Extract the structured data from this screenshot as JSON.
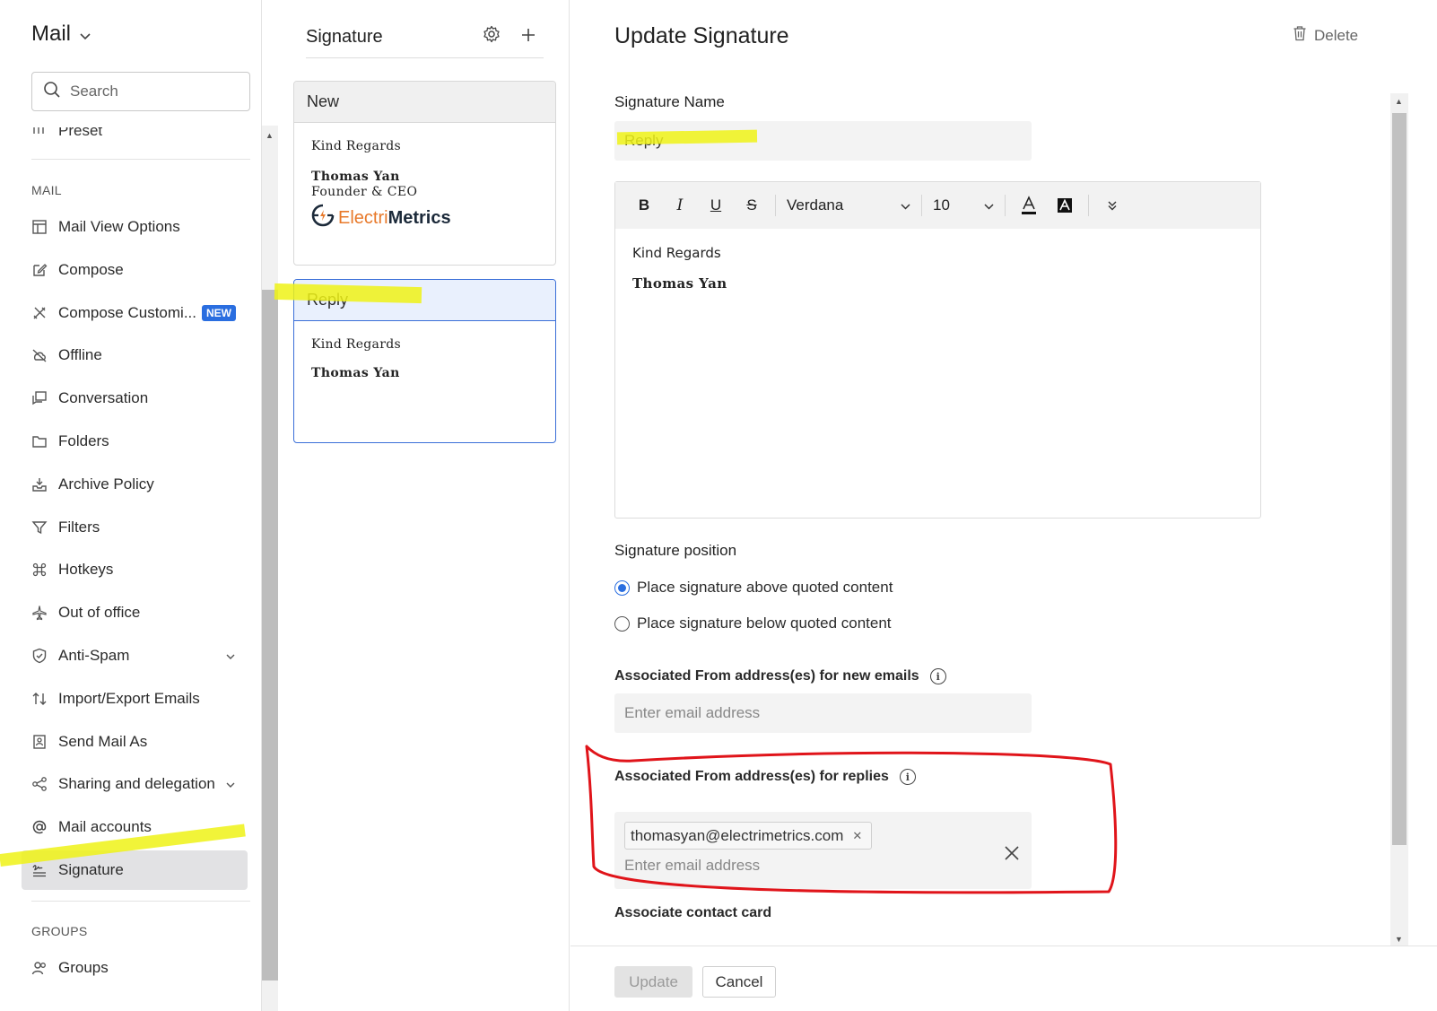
{
  "app": {
    "title": "Mail",
    "search_placeholder": "Search"
  },
  "sidebar": {
    "preset_label": "Preset",
    "section_mail": "MAIL",
    "section_groups": "GROUPS",
    "items": [
      {
        "label": "Mail View Options",
        "icon": "layout-icon"
      },
      {
        "label": "Compose",
        "icon": "compose-icon"
      },
      {
        "label": "Compose Customi...",
        "icon": "tools-icon",
        "badge": "NEW"
      },
      {
        "label": "Offline",
        "icon": "cloud-off-icon"
      },
      {
        "label": "Conversation",
        "icon": "conversation-icon"
      },
      {
        "label": "Folders",
        "icon": "folder-icon"
      },
      {
        "label": "Archive Policy",
        "icon": "archive-icon"
      },
      {
        "label": "Filters",
        "icon": "filter-icon"
      },
      {
        "label": "Hotkeys",
        "icon": "command-icon"
      },
      {
        "label": "Out of office",
        "icon": "plane-icon"
      },
      {
        "label": "Anti-Spam",
        "icon": "shield-icon"
      },
      {
        "label": "Import/Export Emails",
        "icon": "swap-icon"
      },
      {
        "label": "Send Mail As",
        "icon": "send-as-icon"
      },
      {
        "label": "Sharing and delegation",
        "icon": "share-icon"
      },
      {
        "label": "Mail accounts",
        "icon": "at-icon"
      },
      {
        "label": "Signature",
        "icon": "signature-icon",
        "active": true
      }
    ],
    "groups_item": {
      "label": "Groups",
      "icon": "groups-icon"
    }
  },
  "signature_list": {
    "title": "Signature",
    "cards": [
      {
        "name": "New",
        "regards": "Kind Regards",
        "person": "Thomas Yan",
        "role": "Founder & CEO",
        "logo_part1": "Electri",
        "logo_part2": "Metrics"
      },
      {
        "name": "Reply",
        "regards": "Kind Regards",
        "person": "Thomas Yan"
      }
    ]
  },
  "detail": {
    "title": "Update Signature",
    "delete_label": "Delete",
    "name_label": "Signature Name",
    "name_value": "Reply",
    "toolbar": {
      "bold": "B",
      "italic": "I",
      "underline": "U",
      "strike": "S",
      "font": "Verdana",
      "size": "10"
    },
    "editor": {
      "regards": "Kind Regards",
      "person": "Thomas Yan"
    },
    "position_label": "Signature position",
    "position_options": [
      {
        "label": "Place signature above quoted content",
        "selected": true
      },
      {
        "label": "Place signature below quoted content",
        "selected": false
      }
    ],
    "new_emails_label": "Associated From address(es) for new emails",
    "new_emails_placeholder": "Enter email address",
    "replies_label": "Associated From address(es) for replies",
    "replies_chip": "thomasyan@electrimetrics.com",
    "replies_placeholder": "Enter email address",
    "contact_card_label": "Associate contact card",
    "update_label": "Update",
    "cancel_label": "Cancel"
  },
  "colors": {
    "accent": "#2a6ee0",
    "highlight_yellow": "#eef216",
    "annotation_red": "#e0141a"
  }
}
